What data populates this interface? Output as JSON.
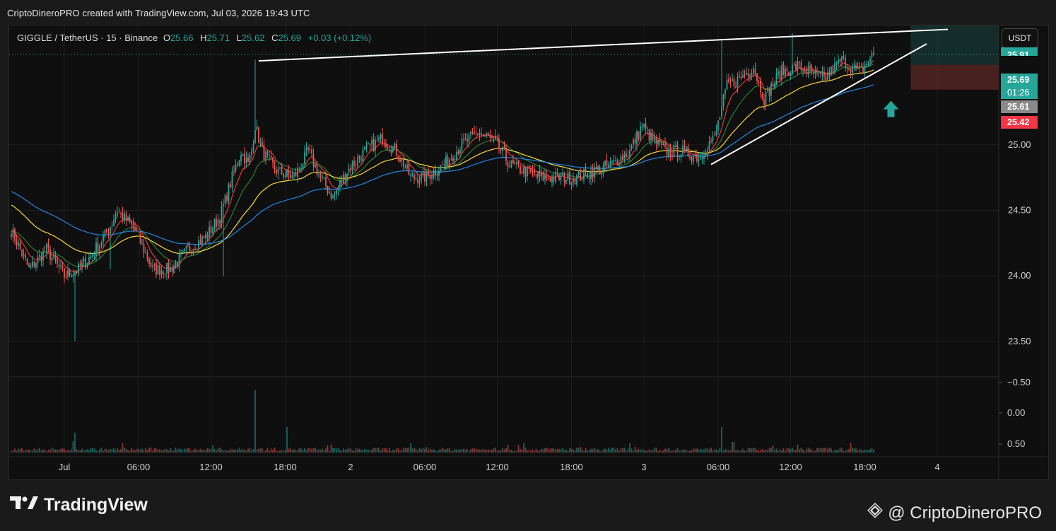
{
  "header": {
    "caption": "CriptoDineroPRO created with TradingView.com, Jul 03, 2026 19:43 UTC"
  },
  "legend": {
    "symbol": "GIGGLE / TetherUS · 15 · Binance",
    "open_label": "O",
    "open": "25.66",
    "high_label": "H",
    "high": "25.71",
    "low_label": "L",
    "low": "25.62",
    "close_label": "C",
    "close": "25.69",
    "change": "+0.03 (+0.12%)"
  },
  "currency_button": "USDT",
  "price_tags": {
    "top_partial": "25.91",
    "last": "25.69",
    "countdown": "01:26",
    "entry": "25.61",
    "stop": "25.42"
  },
  "colors": {
    "up": "#26a69a",
    "down": "#ef5350",
    "ema_red": "#e53935",
    "ema_green": "#2e7d32",
    "ema_yellow": "#fdd835",
    "ema_blue": "#1e88e5",
    "trendline": "#ffffff",
    "arrow": "#26a69a"
  },
  "branding": {
    "logo_icon": "tradingview-logo",
    "name": "TradingView"
  },
  "watermark": {
    "icon": "binance-icon",
    "text": "@ CriptoDineroPRO"
  },
  "chart_data": {
    "type": "candlestick",
    "symbol": "GIGGLE / TetherUS",
    "interval": "15",
    "exchange": "Binance",
    "price_axis": {
      "ticks": [
        "25.00",
        "24.50",
        "24.00",
        "23.50"
      ],
      "range": [
        23.23,
        25.91
      ]
    },
    "volume_axis": {
      "ticks": [
        "−0.50",
        "0.00",
        "0.50"
      ]
    },
    "time_axis": {
      "ticks": [
        "Jul",
        "06:00",
        "12:00",
        "18:00",
        "2",
        "06:00",
        "12:00",
        "18:00",
        "3",
        "06:00",
        "12:00",
        "18:00",
        "4"
      ]
    },
    "price_anchors": [
      [
        0,
        24.35
      ],
      [
        10,
        24.05
      ],
      [
        20,
        24.2
      ],
      [
        30,
        24.0
      ],
      [
        38,
        24.05
      ],
      [
        45,
        24.15
      ],
      [
        55,
        24.35
      ],
      [
        60,
        24.5
      ],
      [
        70,
        24.35
      ],
      [
        80,
        24.05
      ],
      [
        90,
        24.05
      ],
      [
        100,
        24.2
      ],
      [
        110,
        24.3
      ],
      [
        118,
        24.45
      ],
      [
        125,
        24.75
      ],
      [
        130,
        24.95
      ],
      [
        134,
        24.85
      ],
      [
        136,
        24.95
      ],
      [
        138,
        25.15
      ],
      [
        142,
        24.95
      ],
      [
        150,
        24.8
      ],
      [
        160,
        24.75
      ],
      [
        168,
        24.95
      ],
      [
        175,
        24.75
      ],
      [
        182,
        24.6
      ],
      [
        190,
        24.8
      ],
      [
        200,
        24.95
      ],
      [
        210,
        25.05
      ],
      [
        218,
        24.95
      ],
      [
        226,
        24.75
      ],
      [
        234,
        24.75
      ],
      [
        245,
        24.85
      ],
      [
        255,
        25.0
      ],
      [
        265,
        25.1
      ],
      [
        275,
        25.0
      ],
      [
        282,
        24.85
      ],
      [
        290,
        24.8
      ],
      [
        300,
        24.75
      ],
      [
        310,
        24.75
      ],
      [
        320,
        24.75
      ],
      [
        330,
        24.8
      ],
      [
        340,
        24.85
      ],
      [
        350,
        24.95
      ],
      [
        357,
        25.15
      ],
      [
        362,
        25.05
      ],
      [
        370,
        24.95
      ],
      [
        380,
        24.95
      ],
      [
        390,
        24.9
      ],
      [
        394,
        25.0
      ],
      [
        398,
        25.05
      ],
      [
        405,
        25.45
      ],
      [
        412,
        25.5
      ],
      [
        420,
        25.6
      ],
      [
        426,
        25.35
      ],
      [
        435,
        25.55
      ],
      [
        445,
        25.6
      ],
      [
        452,
        25.55
      ],
      [
        460,
        25.5
      ],
      [
        470,
        25.65
      ],
      [
        480,
        25.55
      ],
      [
        488,
        25.69
      ]
    ],
    "spike_bars": [
      [
        36,
        23.5,
        "low"
      ],
      [
        120,
        24.0,
        "low"
      ],
      [
        138,
        25.65,
        "high"
      ],
      [
        402,
        25.8,
        "high"
      ],
      [
        442,
        25.85,
        "high"
      ],
      [
        56,
        24.05,
        "low"
      ]
    ],
    "ema_lines": [
      {
        "name": "EMA red",
        "period": 9
      },
      {
        "name": "EMA green",
        "period": 21
      },
      {
        "name": "EMA yellow",
        "period": 50
      },
      {
        "name": "EMA blue",
        "period": 100,
        "start": 24.65
      }
    ],
    "trendlines": [
      {
        "kind": "resistance",
        "from": [
          140,
          25.64
        ],
        "to": [
          530,
          25.88
        ]
      },
      {
        "kind": "support",
        "from": [
          396,
          24.85
        ],
        "to": [
          518,
          25.77
        ]
      }
    ],
    "position": {
      "entry": 25.61,
      "target": 25.91,
      "stop": 25.42,
      "side": "long"
    },
    "signal": {
      "type": "arrow-up",
      "bar": 493,
      "price": 25.27
    },
    "last_price": 25.69,
    "volume": {
      "base": "low",
      "spikes": [
        [
          138,
          "large"
        ],
        [
          402,
          "medium"
        ],
        [
          156,
          "medium"
        ],
        [
          36,
          "small"
        ]
      ]
    }
  }
}
